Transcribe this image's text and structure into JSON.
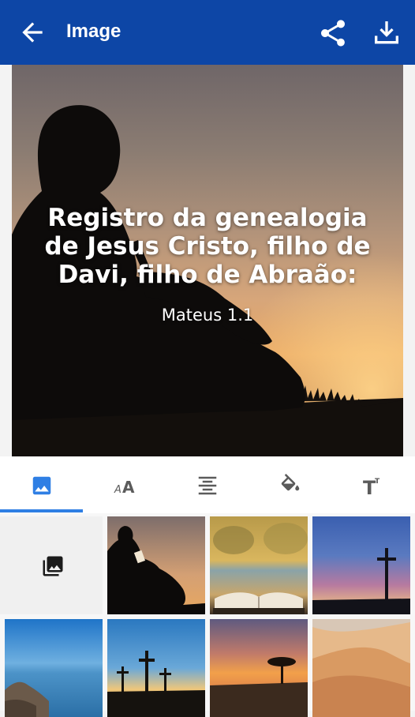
{
  "appbar": {
    "title": "Image",
    "back_icon": "arrow-back-icon",
    "share_icon": "share-icon",
    "download_icon": "download-icon",
    "background": "#0d46a6"
  },
  "preview": {
    "verse": "Registro da genealogia de Jesus Cristo, filho de Davi, filho de Abraão:",
    "reference": "Mateus 1.1"
  },
  "tabs": [
    {
      "icon": "image-icon",
      "selected": true
    },
    {
      "icon": "font-size-icon",
      "selected": false
    },
    {
      "icon": "align-center-icon",
      "selected": false
    },
    {
      "icon": "paint-bucket-icon",
      "selected": false
    },
    {
      "icon": "text-format-icon",
      "selected": false
    }
  ],
  "accent": "#2f7fe4",
  "gallery": {
    "picker_icon": "photo-library-icon",
    "thumbnails": [
      "boy-reading-sunset",
      "open-bible-lake",
      "cross-sunset",
      "rocky-coast-sea",
      "three-crosses",
      "acacia-sunset",
      "desert-dunes"
    ]
  }
}
